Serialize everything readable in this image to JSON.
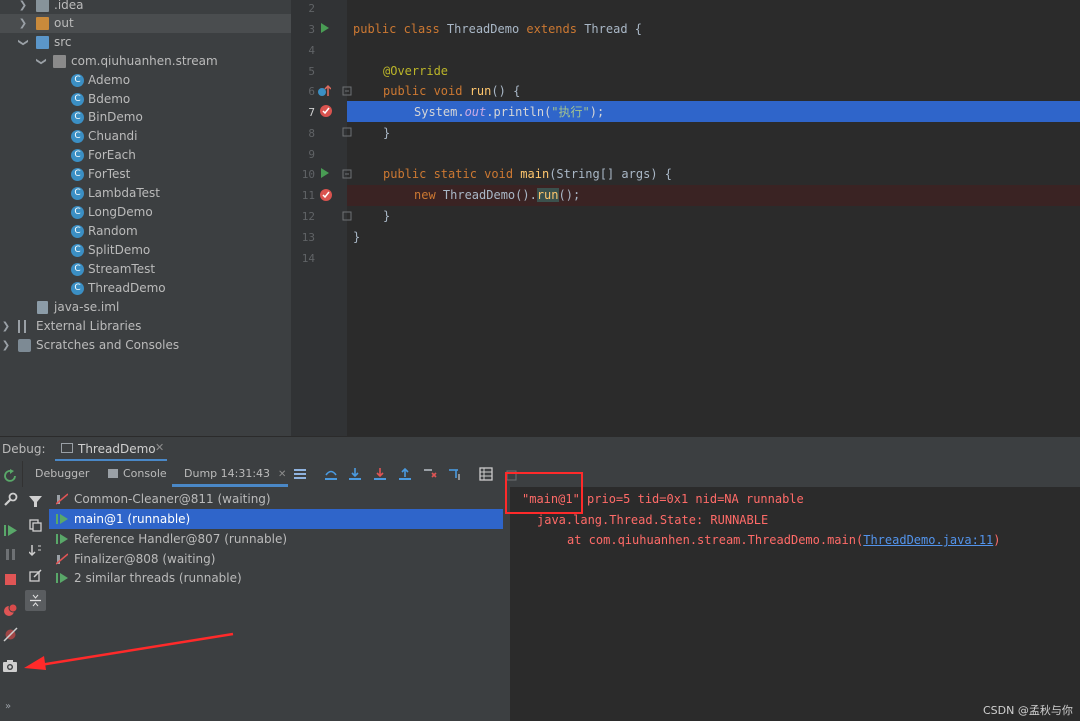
{
  "project_tree": {
    "items": [
      {
        "label": ".idea",
        "icon": "folder-icon",
        "color": "gray"
      },
      {
        "label": "out",
        "icon": "folder-icon",
        "color": "orange"
      },
      {
        "label": "src",
        "icon": "folder-icon",
        "color": "blue"
      },
      {
        "label": "com.qiuhuanhen.stream",
        "icon": "package-icon"
      },
      {
        "label": "Ademo",
        "icon": "java-class-icon"
      },
      {
        "label": "Bdemo",
        "icon": "java-class-icon"
      },
      {
        "label": "BinDemo",
        "icon": "java-class-icon"
      },
      {
        "label": "Chuandi",
        "icon": "java-class-icon"
      },
      {
        "label": "ForEach",
        "icon": "java-class-icon"
      },
      {
        "label": "ForTest",
        "icon": "java-class-icon"
      },
      {
        "label": "LambdaTest",
        "icon": "java-class-icon"
      },
      {
        "label": "LongDemo",
        "icon": "java-class-icon"
      },
      {
        "label": "Random",
        "icon": "java-class-icon"
      },
      {
        "label": "SplitDemo",
        "icon": "java-class-icon"
      },
      {
        "label": "StreamTest",
        "icon": "java-class-icon"
      },
      {
        "label": "ThreadDemo",
        "icon": "java-class-icon"
      },
      {
        "label": "java-se.iml",
        "icon": "iml-file-icon"
      },
      {
        "label": "External Libraries",
        "icon": "libraries-icon"
      },
      {
        "label": "Scratches and Consoles",
        "icon": "scratches-icon"
      }
    ]
  },
  "editor": {
    "line_numbers": [
      "2",
      "3",
      "4",
      "5",
      "6",
      "7",
      "8",
      "9",
      "10",
      "11",
      "12",
      "13",
      "14"
    ],
    "code": {
      "l3_kw1": "public class ",
      "l3_name": "ThreadDemo ",
      "l3_kw2": "extends ",
      "l3_rest": "Thread {",
      "l5_ann": "@Override",
      "l6_kw": "public void ",
      "l6_fn": "run",
      "l6_rest": "() {",
      "l7_a": "System.",
      "l7_fld": "out",
      "l7_b": ".println(",
      "l7_str": "\"执行\"",
      "l7_c": ");",
      "l8": "}",
      "l10_kw": "public static void ",
      "l10_fn": "main",
      "l10_rest": "(String[] args) {",
      "l11_kw": "new ",
      "l11_a": "ThreadDemo().",
      "l11_fn": "run",
      "l11_b": "();",
      "l12": "}",
      "l13": "}"
    }
  },
  "debug": {
    "label": "Debug:",
    "session_tab": "ThreadDemo",
    "tabs": [
      "Debugger",
      "Console",
      "Dump 14:31:43"
    ],
    "threads": [
      {
        "label": "Common-Cleaner@811 (waiting)",
        "state": "waiting"
      },
      {
        "label": "main@1 (runnable)",
        "state": "runnable",
        "selected": true
      },
      {
        "label": "Reference Handler@807 (runnable)",
        "state": "runnable"
      },
      {
        "label": "Finalizer@808 (waiting)",
        "state": "waiting"
      },
      {
        "label": "2 similar threads (runnable)",
        "state": "runnable"
      }
    ],
    "dump": {
      "line1_name": "\"main@1\"",
      "line1_rest": " prio=5 tid=0x1 nid=NA runnable",
      "line2": "java.lang.Thread.State: RUNNABLE",
      "line3_prefix": "at com.qiuhuanhen.stream.ThreadDemo.main(",
      "line3_link": "ThreadDemo.java:11",
      "line3_suffix": ")"
    }
  },
  "watermark": "CSDN @孟秋与你",
  "colors": {
    "selection": "#2f65ca",
    "breakpoint_line": "#3a2323",
    "annotation_red": "#ff2a2a"
  }
}
